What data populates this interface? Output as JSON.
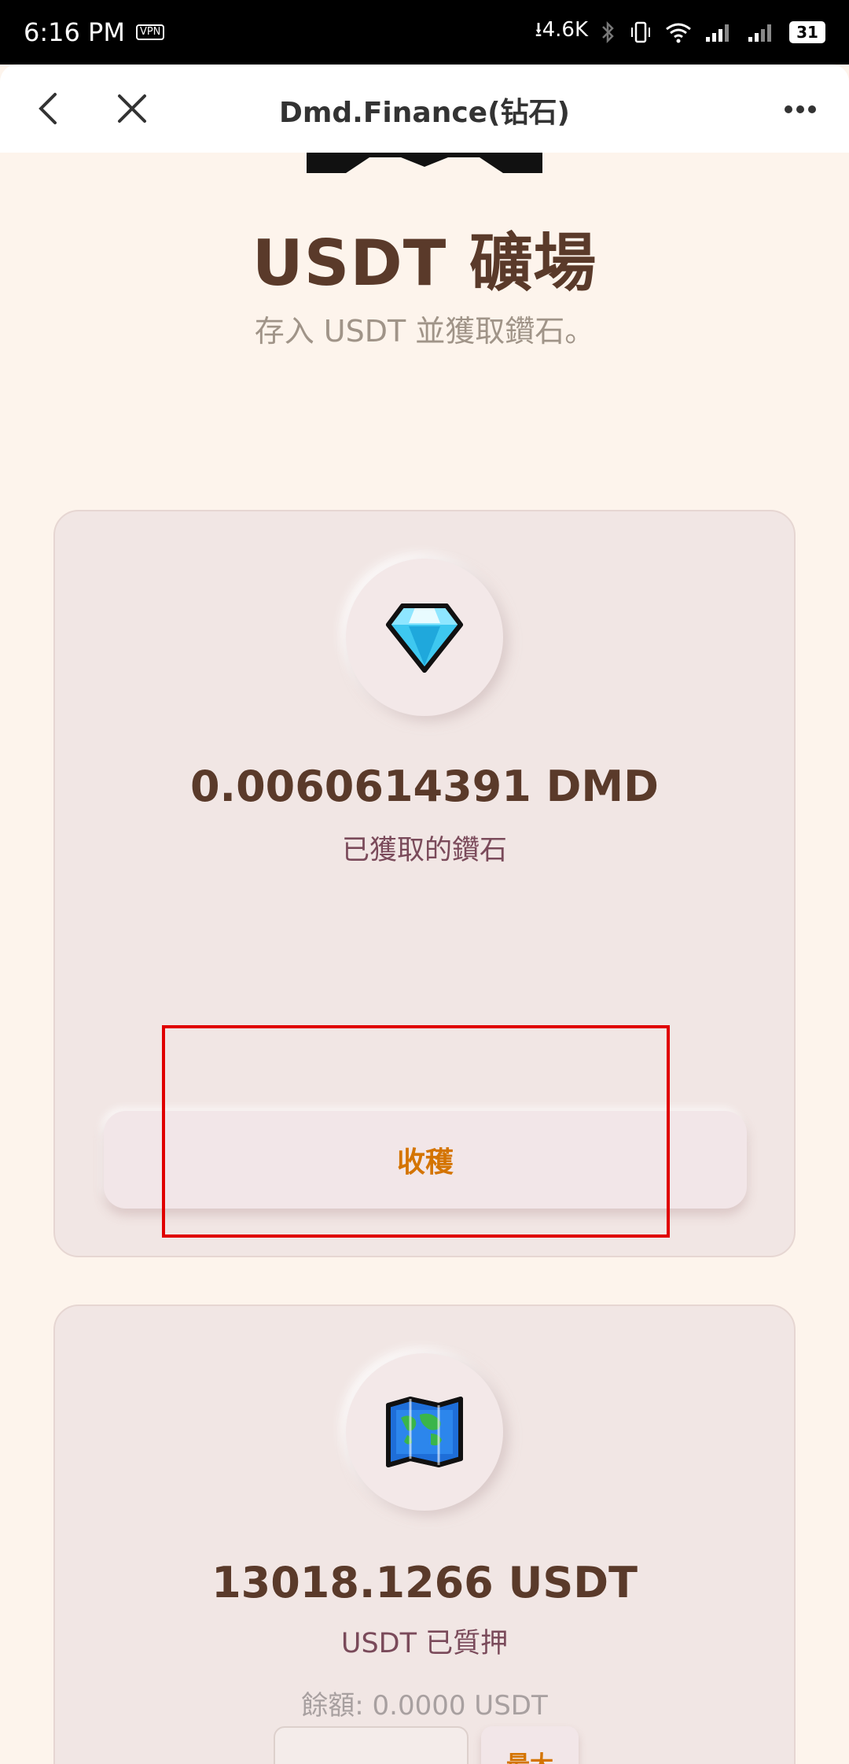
{
  "status_bar": {
    "time": "6:16 PM",
    "vpn": "VPN",
    "net_speed": "4.6K",
    "battery": "31"
  },
  "nav": {
    "title": "Dmd.Finance(钻石)"
  },
  "hero": {
    "title": "USDT 礦場",
    "subtitle": "存入 USDT 並獲取鑽石。"
  },
  "earned_card": {
    "amount": "0.0060614391 DMD",
    "label": "已獲取的鑽石",
    "harvest_label": "收穫"
  },
  "staked_card": {
    "amount": "13018.1266 USDT",
    "label": "USDT 已質押",
    "balance": "餘額: 0.0000 USDT",
    "input_value": "",
    "max_label": "最大"
  },
  "colors": {
    "background": "#fdf4ec",
    "card": "#f1e6e4",
    "accent": "#d47400",
    "text_dark": "#5a3a2a",
    "highlight_box": "#e00000"
  }
}
